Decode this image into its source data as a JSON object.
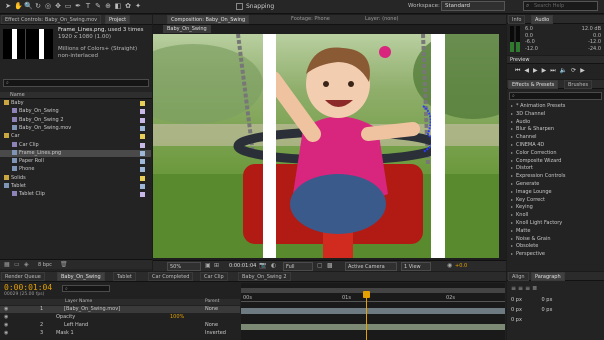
{
  "toolbar": {
    "snapping_label": "Snapping",
    "workspace_label": "Workspace:",
    "workspace_value": "Standard",
    "search_placeholder": "Search Help"
  },
  "project_panel": {
    "tabs": [
      "Effect Controls: Baby_On_Swing.mov",
      "Project"
    ],
    "selected_name": "Frame_Lines.png",
    "selected_used": ", used 3 times",
    "selected_dims": "1920 x 1080 (1.00)",
    "selected_colors": "Millions of Colors+ (Straight)",
    "selected_interlace": "non-interlaced",
    "column_name": "Name",
    "items": [
      {
        "name": "Baby",
        "type": "folder",
        "indent": 0,
        "label": "#e8cf5a"
      },
      {
        "name": "Baby_On_Swing",
        "type": "comp",
        "indent": 1,
        "label": "#c8b8e8"
      },
      {
        "name": "Baby_On_Swing 2",
        "type": "comp",
        "indent": 1,
        "label": "#c8b8e8"
      },
      {
        "name": "Baby_On_Swing.mov",
        "type": "footage",
        "indent": 1,
        "label": "#9fb7d8"
      },
      {
        "name": "Car",
        "type": "folder",
        "indent": 0,
        "label": "#e8cf5a"
      },
      {
        "name": "Car Clip",
        "type": "comp",
        "indent": 1,
        "label": "#c8b8e8"
      },
      {
        "name": "Frame_Lines.png",
        "type": "footage",
        "indent": 1,
        "label": "#9fb7d8",
        "selected": true
      },
      {
        "name": "Paper Roll",
        "type": "footage",
        "indent": 1,
        "label": "#9fb7d8"
      },
      {
        "name": "Phone",
        "type": "footage",
        "indent": 1,
        "label": "#9fb7d8"
      },
      {
        "name": "Solids",
        "type": "folder",
        "indent": 0,
        "label": "#e8cf5a"
      },
      {
        "name": "Tablet",
        "type": "footage",
        "indent": 0,
        "label": "#9fb7d8"
      },
      {
        "name": "Tablet Clip",
        "type": "comp",
        "indent": 1,
        "label": "#c8b8e8"
      }
    ],
    "bpc": "8 bpc"
  },
  "composition_panel": {
    "tab_label": "Composition: Baby_On_Swing",
    "footage_tab": "Footage: Phone",
    "layer_tab": "Layer: (none)",
    "comp_name_tab": "Baby_On_Swing",
    "zoom": "50%",
    "timecode": "0:00:01:04",
    "resolution": "Full",
    "camera": "Active Camera",
    "view": "1 View",
    "exposure": "+0.0"
  },
  "info_panel": {
    "tabs": [
      "Info",
      "Audio"
    ],
    "db_values": [
      "6.0",
      "0.0",
      "-6.0",
      "-12.0"
    ],
    "db_right": [
      "12.0 dB",
      "0.0",
      "-12.0",
      "-24.0"
    ]
  },
  "preview_panel": {
    "label": "Preview"
  },
  "effects_panel": {
    "tabs": [
      "Effects & Presets",
      "Brushes"
    ],
    "categories": [
      "* Animation Presets",
      "3D Channel",
      "Audio",
      "Blur & Sharpen",
      "Channel",
      "CINEMA 4D",
      "Color Correction",
      "Composite Wizard",
      "Distort",
      "Expression Controls",
      "Generate",
      "Image Lounge",
      "Key Correct",
      "Keying",
      "Knoll",
      "Knoll Light Factory",
      "Matte",
      "Noise & Grain",
      "Obsolete",
      "Perspective"
    ]
  },
  "timeline": {
    "tabs": [
      "Render Queue",
      "Baby_On_Swing",
      "Tablet",
      "Car Completed",
      "Car Clip",
      "Baby_On_Swing 2"
    ],
    "current_time": "0:00:01:04",
    "frame_info": "00029 (25.00 fps)",
    "column_layer_name": "Layer Name",
    "column_parent": "Parent",
    "layers": [
      {
        "num": "1",
        "name": "[Baby_On_Swing.mov]",
        "parent": "None"
      },
      {
        "num": "",
        "name": "Opacity",
        "parent": "100%"
      },
      {
        "num": "2",
        "name": "Left Hand",
        "parent": "None"
      },
      {
        "num": "3",
        "name": "Mask 1",
        "parent": "Inverted"
      }
    ],
    "ruler_labels": [
      "00s",
      "01s",
      "02s"
    ]
  },
  "align_panel": {
    "tabs": [
      "Align",
      "Paragraph"
    ],
    "fields": [
      "0 px",
      "0 px",
      "0 px",
      "0 px",
      "0 px"
    ]
  },
  "colors": {
    "accent": "#e5a100",
    "selection": "#4a4a4a",
    "panel": "#232323",
    "timecode": "#e5a100"
  }
}
